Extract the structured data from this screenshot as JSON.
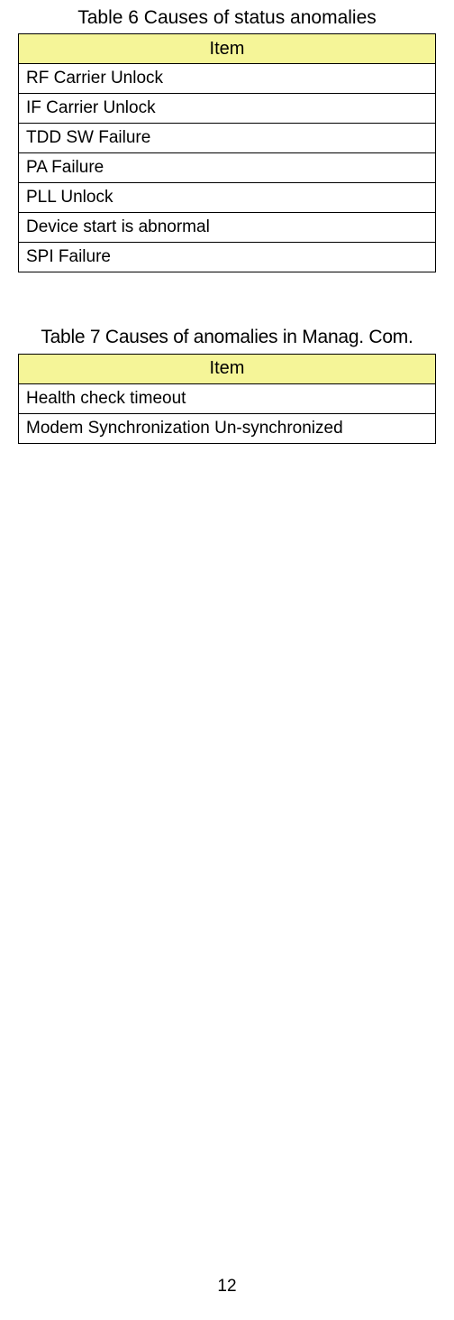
{
  "table6": {
    "caption": "Table 6 Causes of status anomalies",
    "header": "Item",
    "rows": [
      "RF Carrier Unlock",
      "IF Carrier Unlock",
      "TDD SW Failure",
      "PA Failure",
      "PLL Unlock",
      "Device start is abnormal",
      "SPI Failure"
    ]
  },
  "table7": {
    "caption": "Table 7 Causes of anomalies in Manag. Com.",
    "header": "Item",
    "rows": [
      "Health check timeout",
      "Modem Synchronization Un-synchronized"
    ]
  },
  "page_number": "12"
}
